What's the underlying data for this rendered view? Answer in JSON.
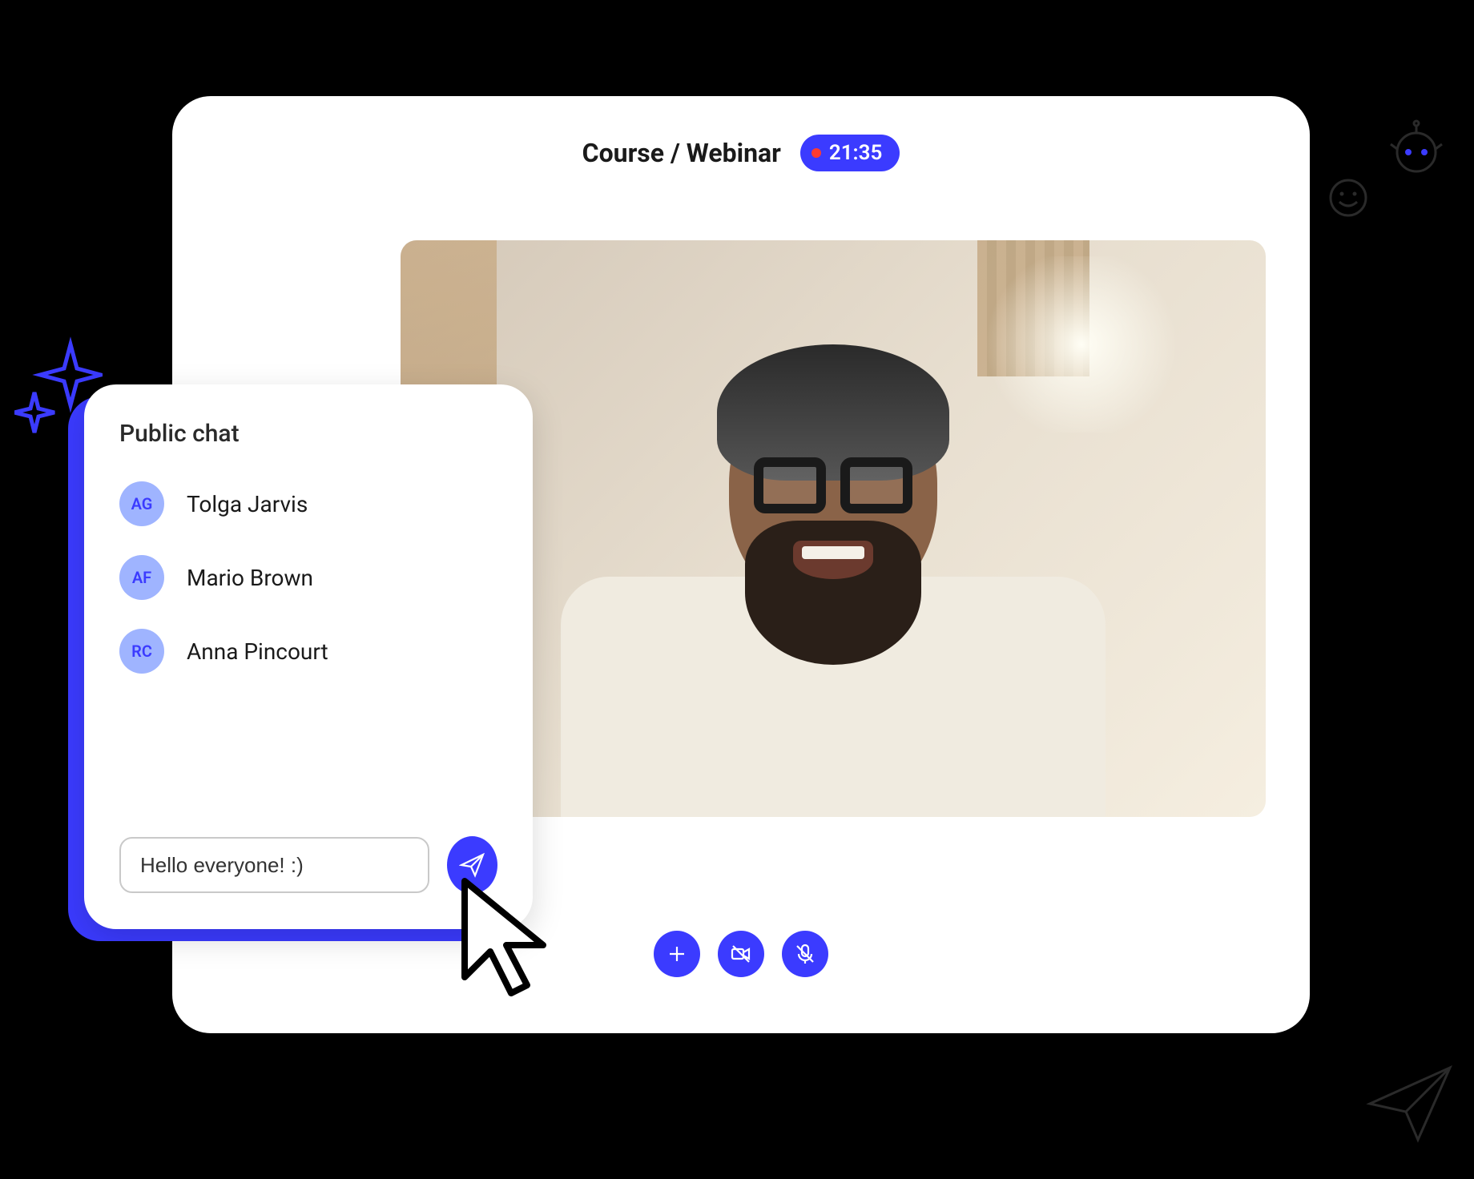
{
  "header": {
    "title": "Course / Webinar",
    "timer": "21:35"
  },
  "controls": {
    "add": "add-button",
    "camera_off": "camera-off-button",
    "mic_off": "mic-off-button"
  },
  "chat": {
    "title": "Public chat",
    "participants": [
      {
        "initials": "AG",
        "name": "Tolga Jarvis"
      },
      {
        "initials": "AF",
        "name": "Mario Brown"
      },
      {
        "initials": "RC",
        "name": "Anna Pincourt"
      }
    ],
    "input_value": "Hello everyone! :)"
  },
  "colors": {
    "accent": "#3b3bff",
    "avatar_bg": "#9fb4ff",
    "rec_dot": "#ff3b30"
  }
}
